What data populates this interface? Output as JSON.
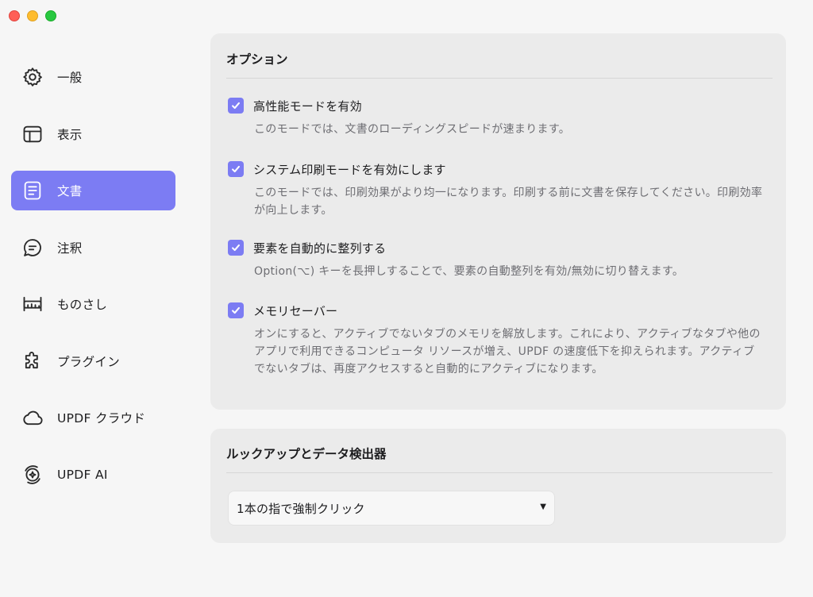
{
  "sidebar": {
    "items": [
      {
        "label": "一般",
        "icon": "gear-icon",
        "active": false
      },
      {
        "label": "表示",
        "icon": "layout-icon",
        "active": false
      },
      {
        "label": "文書",
        "icon": "document-icon",
        "active": true
      },
      {
        "label": "注釈",
        "icon": "comment-icon",
        "active": false
      },
      {
        "label": "ものさし",
        "icon": "ruler-icon",
        "active": false
      },
      {
        "label": "プラグイン",
        "icon": "puzzle-icon",
        "active": false
      },
      {
        "label": "UPDF クラウド",
        "icon": "cloud-icon",
        "active": false
      },
      {
        "label": "UPDF AI",
        "icon": "ai-icon",
        "active": false
      }
    ]
  },
  "options": {
    "title": "オプション",
    "items": [
      {
        "title": "高性能モードを有効",
        "desc": "このモードでは、文書のローディングスピードが速まります。",
        "checked": true
      },
      {
        "title": "システム印刷モードを有効にします",
        "desc": "このモードでは、印刷効果がより均一になります。印刷する前に文書を保存してください。印刷効率が向上します。",
        "checked": true
      },
      {
        "title": "要素を自動的に整列する",
        "desc": "Option(⌥) キーを長押しすることで、要素の自動整列を有効/無効に切り替えます。",
        "checked": true
      },
      {
        "title": "メモリセーバー",
        "desc": "オンにすると、アクティブでないタブのメモリを解放します。これにより、アクティブなタブや他のアプリで利用できるコンピュータ リソースが増え、UPDF の速度低下を抑えられます。アクティブでないタブは、再度アクセスすると自動的にアクティブになります。",
        "checked": true
      }
    ]
  },
  "lookup": {
    "title": "ルックアップとデータ検出器",
    "dropdown_value": "1本の指で強制クリック",
    "caret": "▼"
  },
  "colors": {
    "accent": "#7c7cf3",
    "background": "#f6f6f6",
    "panel": "#ebebeb"
  }
}
